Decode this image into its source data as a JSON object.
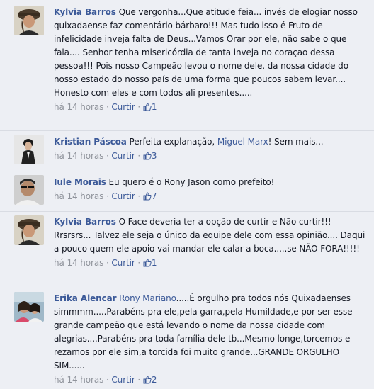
{
  "comments": [
    {
      "author": "Kylvia Barros",
      "mention": "",
      "text": "Que vergonha...Que atitude feia... invés de elogiar nosso quixadaense faz comentário bárbaro!!! Mas tudo isso é Fruto de infelicidade inveja falta de Deus...Vamos Orar por ele, não sabe o que fala.... Senhor tenha misericórdia de tanta inveja no coraçao dessa pessoa!!! Pois nosso Campeão levou o nome dele, da nossa cidade do nosso estado do nosso país de uma forma que poucos sabem levar.... Honesto com eles e com todos ali presentes.....",
      "text_after": "",
      "time": "há 14 horas",
      "like_label": "Curtir",
      "likes": "1"
    },
    {
      "author": "Kristian Páscoa",
      "mention": "Miguel Marx",
      "text": "Perfeita explanação,",
      "text_after": "! Sem mais...",
      "time": "há 14 horas",
      "like_label": "Curtir",
      "likes": "3"
    },
    {
      "author": "Iule Morais",
      "mention": "",
      "text": "Eu quero é o Rony Jason como prefeito!",
      "text_after": "",
      "time": "há 14 horas",
      "like_label": "Curtir",
      "likes": "7"
    },
    {
      "author": "Kylvia Barros",
      "mention": "",
      "text": "O Face deveria ter a opção de curtir e Não curtir!!! Rrsrsrs... Talvez ele seja o único da equipe dele com essa opinião.... Daqui a pouco quem ele apoio vai mandar ele calar a boca.....se NÃO FORA!!!!!",
      "text_after": "",
      "time": "há 14 horas",
      "like_label": "Curtir",
      "likes": "1"
    },
    {
      "author": "Erika Alencar",
      "mention": "Rony Mariano",
      "text": "",
      "text_after": ".....É orgulho pra todos nós Quixadaenses simmmm.....Parabéns pra ele,pela garra,pela Humildade,e por ser esse grande campeão que está levando o nome da nossa cidade com alegrias....Parabéns pra toda família dele tb...Mesmo longe,torcemos e rezamos por ele sim,a torcida foi muito grande...GRANDE ORGULHO SIM......",
      "time": "há 14 horas",
      "like_label": "Curtir",
      "likes": "2"
    }
  ],
  "separator": "·",
  "colors": {
    "link": "#3b5998",
    "meta": "#90949c",
    "background": "#edeff4",
    "divider": "#d9dce3"
  }
}
